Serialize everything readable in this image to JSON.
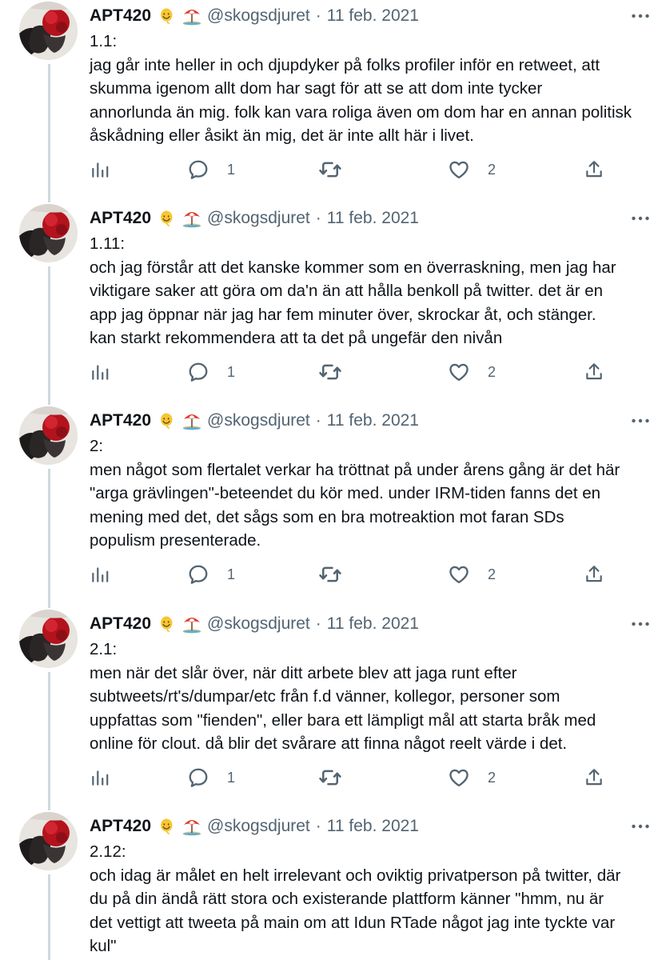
{
  "tweets": [
    {
      "display_name": "APT420",
      "emojis": [
        "smiling-face-icon",
        "beach-umbrella-icon"
      ],
      "handle": "@skogsdjuret",
      "separator": "·",
      "date": "11 feb. 2021",
      "lines": [
        "1.1:",
        "jag går inte heller in och djupdyker på folks profiler inför en retweet, att",
        "skumma igenom allt dom har sagt för att se att dom inte tycker",
        "annorlunda än mig. folk kan vara roliga även om dom har en annan politisk",
        "åskådning eller åsikt än mig, det är inte allt här i livet."
      ],
      "reply_count": "1",
      "like_count": "2"
    },
    {
      "display_name": "APT420",
      "emojis": [
        "smiling-face-icon",
        "beach-umbrella-icon"
      ],
      "handle": "@skogsdjuret",
      "separator": "·",
      "date": "11 feb. 2021",
      "lines": [
        "1.11:",
        "och jag förstår att det kanske kommer som en överraskning, men jag har",
        "viktigare saker att göra om da'n än att hålla benkoll på twitter. det är en",
        "app jag öppnar när jag har fem minuter över, skrockar åt, och stänger.",
        "kan starkt rekommendera att ta det på ungefär den nivån"
      ],
      "reply_count": "1",
      "like_count": "2"
    },
    {
      "display_name": "APT420",
      "emojis": [
        "smiling-face-icon",
        "beach-umbrella-icon"
      ],
      "handle": "@skogsdjuret",
      "separator": "·",
      "date": "11 feb. 2021",
      "lines": [
        "2:",
        "men något som flertalet verkar ha tröttnat på under årens gång är det här",
        "\"arga grävlingen\"-beteendet du kör med. under IRM-tiden fanns det en",
        "mening med det, det sågs som en bra motreaktion mot faran SDs",
        "populism presenterade."
      ],
      "reply_count": "1",
      "like_count": "2"
    },
    {
      "display_name": "APT420",
      "emojis": [
        "smiling-face-icon",
        "beach-umbrella-icon"
      ],
      "handle": "@skogsdjuret",
      "separator": "·",
      "date": "11 feb. 2021",
      "lines": [
        "2.1:",
        "men när det slår över, när ditt arbete blev att jaga runt efter",
        "subtweets/rt's/dumpar/etc från f.d vänner, kollegor, personer som",
        "uppfattas som \"fienden\", eller bara ett lämpligt mål att starta bråk med",
        "online för clout. då blir det svårare att finna något reelt värde i det."
      ],
      "reply_count": "1",
      "like_count": "2"
    },
    {
      "display_name": "APT420",
      "emojis": [
        "smiling-face-icon",
        "beach-umbrella-icon"
      ],
      "handle": "@skogsdjuret",
      "separator": "·",
      "date": "11 feb. 2021",
      "lines": [
        "2.12:",
        "och idag är målet en helt irrelevant och oviktig privatperson på twitter, där",
        "du på din ändå rätt stora och existerande plattform känner \"hmm, nu är",
        "det vettigt att tweeta på main om att Idun RTade något jag inte tyckte var",
        "kul\""
      ],
      "reply_count": "",
      "like_count": ""
    }
  ],
  "colors": {
    "text_primary": "#0f1419",
    "text_secondary": "#536471",
    "thread_line": "#cfd9de",
    "avatar_hair": "#b3131c"
  },
  "icons": {
    "more": "more-dots-icon",
    "views": "views-bar-chart-icon",
    "reply": "reply-bubble-icon",
    "retweet": "retweet-icon",
    "like": "heart-icon",
    "share": "share-upload-icon"
  }
}
